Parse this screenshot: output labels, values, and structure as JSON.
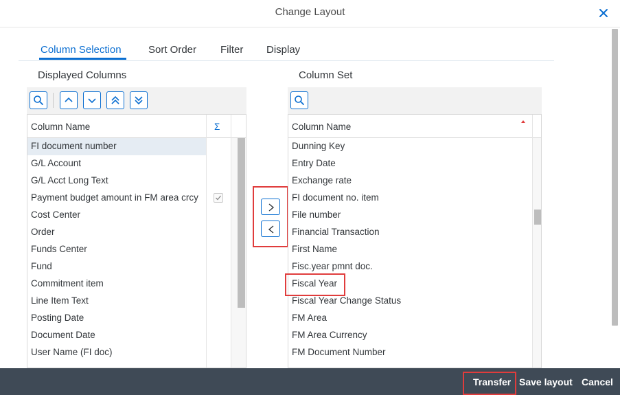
{
  "dialog": {
    "title": "Change Layout",
    "close_icon": "close-icon"
  },
  "tabs": [
    {
      "label": "Column Selection",
      "active": true
    },
    {
      "label": "Sort Order",
      "active": false
    },
    {
      "label": "Filter",
      "active": false
    },
    {
      "label": "Display",
      "active": false
    }
  ],
  "displayed": {
    "label": "Displayed Columns",
    "header": "Column Name",
    "sigma_header": "Σ",
    "rows": [
      "FI document number",
      "G/L Account",
      "G/L Acct Long Text",
      "Payment budget amount in FM area crcy",
      "Cost Center",
      "Order",
      "Funds Center",
      "Fund",
      "Commitment item",
      "Line Item Text",
      "Posting Date",
      "Document Date",
      "User Name (FI doc)"
    ],
    "selected_row": "FI document number",
    "checked_sum_row": "Payment budget amount in FM area crcy"
  },
  "column_set": {
    "label": "Column Set",
    "header": "Column Name",
    "rows": [
      "Dunning Key",
      "Entry Date",
      "Exchange rate",
      "FI document no. item",
      "File number",
      "Financial Transaction",
      "First Name",
      "Fisc.year pmnt doc.",
      "Fiscal Year",
      "Fiscal Year Change Status",
      "FM Area",
      "FM Area Currency",
      "FM Document Number"
    ],
    "highlighted_row": "Fiscal Year"
  },
  "toolbar_icons": [
    "search-icon",
    "move-up-icon",
    "move-down-icon",
    "move-top-icon",
    "move-bottom-icon"
  ],
  "footer": {
    "transfer": "Transfer",
    "save_layout": "Save layout",
    "cancel": "Cancel"
  },
  "colors": {
    "accent": "#0a6ed1",
    "highlight": "#e03c3c",
    "footer_bg": "#3f4a56",
    "selected_row": "#e5ecf3"
  }
}
